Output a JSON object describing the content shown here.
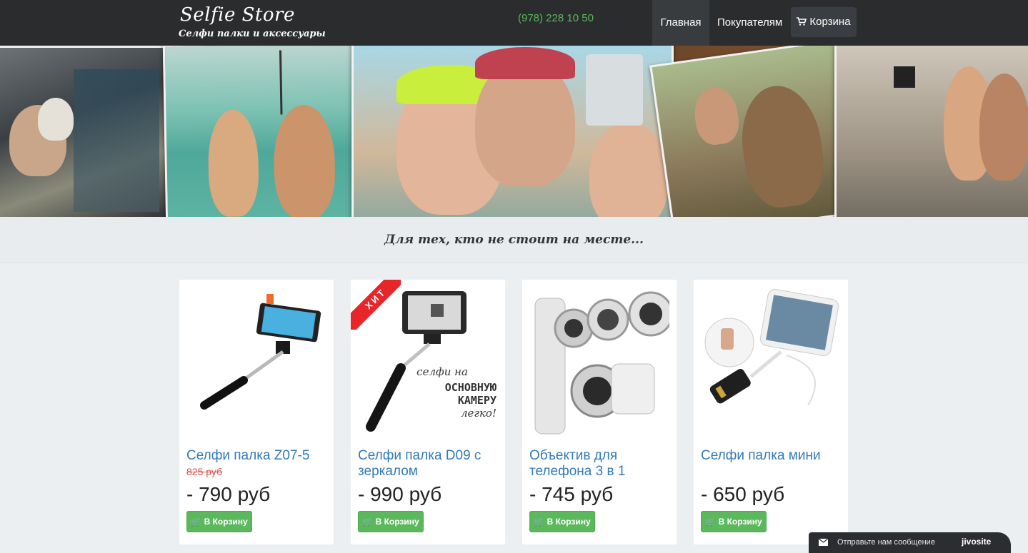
{
  "header": {
    "brand_title": "Selfie Store",
    "brand_subtitle": "Селфи палки и аксессуары",
    "phone": "(978) 228 10 50",
    "nav": {
      "home": "Главная",
      "buyers": "Покупателям",
      "cart": "Корзина"
    }
  },
  "tagline": "Для тех, кто не стоит на месте...",
  "products": [
    {
      "title": "Селфи палка Z07-5",
      "old_price": "825 руб",
      "price": "- 790 руб",
      "button": "В Корзину"
    },
    {
      "title": "Селфи палка D09 с зеркалом",
      "badge": "ХИТ",
      "image_caption": {
        "line1": "селфи на",
        "line2": "ОСНОВНУЮ",
        "line3": "КАМЕРУ",
        "line4": "легко!"
      },
      "price": "- 990 руб",
      "button": "В Корзину"
    },
    {
      "title": "Объектив для телефона 3 в 1",
      "price": "- 745 руб",
      "button": "В Корзину"
    },
    {
      "title": "Селфи палка мини",
      "price": "- 650 руб",
      "button": "В Корзину"
    }
  ],
  "chat": {
    "label": "Отправьте нам сообщение",
    "brand": "jivosite"
  },
  "colors": {
    "navbar": "#2a2c2e",
    "phone": "#5cb85c",
    "link": "#337ab7",
    "old_price": "#d9534f",
    "button": "#5cb85c",
    "ribbon": "#e8262a"
  }
}
